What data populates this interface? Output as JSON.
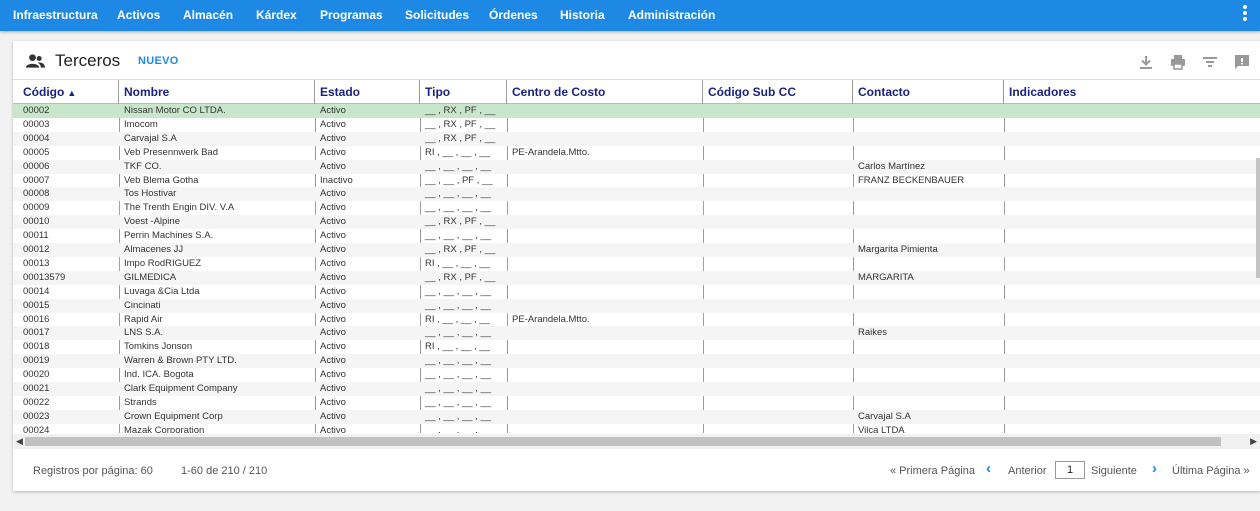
{
  "nav": {
    "items": [
      "Infraestructura",
      "Activos",
      "Almacén",
      "Kárdex",
      "Programas",
      "Solicitudes",
      "Órdenes",
      "Historia",
      "Administración"
    ]
  },
  "page": {
    "title": "Terceros",
    "new_label": "NUEVO"
  },
  "table": {
    "columns": [
      "Código",
      "Nombre",
      "Estado",
      "Tipo",
      "Centro de Costo",
      "Código Sub CC",
      "Contacto",
      "Indicadores"
    ],
    "rows": [
      [
        "00002",
        "Nissan Motor CO LTDA.",
        "Activo",
        "__ , RX , PF , __",
        "",
        "",
        "",
        ""
      ],
      [
        "00003",
        "Imocom",
        "Activo",
        "__ , RX , PF , __",
        "",
        "",
        "",
        ""
      ],
      [
        "00004",
        "Carvajal S.A",
        "Activo",
        "__ , RX , PF , __",
        "",
        "",
        "",
        ""
      ],
      [
        "00005",
        "Veb Presennwerk Bad",
        "Activo",
        "RI , __ , __ , __",
        "PE-Arandela.Mtto.",
        "",
        "",
        ""
      ],
      [
        "00006",
        "TKF CO.",
        "Activo",
        "__ , __ , __ , __",
        "",
        "",
        "Carlos Martínez",
        ""
      ],
      [
        "00007",
        "Veb Blema Gotha",
        "Inactivo",
        "__ , __ , PF , __",
        "",
        "",
        "FRANZ BECKENBAUER",
        ""
      ],
      [
        "00008",
        "Tos Hostivar",
        "Activo",
        "__ , __ , __ , __",
        "",
        "",
        "",
        ""
      ],
      [
        "00009",
        "The Trenth Engin DIV. V.A",
        "Activo",
        "__ , __ , __ , __",
        "",
        "",
        "",
        ""
      ],
      [
        "00010",
        "Voest -Alpine",
        "Activo",
        "__ , RX , PF , __",
        "",
        "",
        "",
        ""
      ],
      [
        "00011",
        "Perrin Machines S.A.",
        "Activo",
        "__ , __ , __ , __",
        "",
        "",
        "",
        ""
      ],
      [
        "00012",
        "Almacenes JJ",
        "Activo",
        "__ , RX , PF , __",
        "",
        "",
        "Margarita Pimienta",
        ""
      ],
      [
        "00013",
        "Impo RodRIGUEZ",
        "Activo",
        "RI , __ , __ , __",
        "",
        "",
        "",
        ""
      ],
      [
        "00013579",
        "GILMEDICA",
        "Activo",
        "__ , RX , PF , __",
        "",
        "",
        "MARGARITA",
        ""
      ],
      [
        "00014",
        "Luvaga &Cia Ltda",
        "Activo",
        "__ , __ , __ , __",
        "",
        "",
        "",
        ""
      ],
      [
        "00015",
        "Cincinati",
        "Activo",
        "__ , __ , __ , __",
        "",
        "",
        "",
        ""
      ],
      [
        "00016",
        "Rapid Air",
        "Activo",
        "RI , __ , __ , __",
        "PE-Arandela.Mtto.",
        "",
        "",
        ""
      ],
      [
        "00017",
        "LNS S.A.",
        "Activo",
        "__ , __ , __ , __",
        "",
        "",
        "Raikes",
        ""
      ],
      [
        "00018",
        "Tomkins Jonson",
        "Activo",
        "RI , __ , __ , __",
        "",
        "",
        "",
        ""
      ],
      [
        "00019",
        "Warren & Brown PTY LTD.",
        "Activo",
        "__ , __ , __ , __",
        "",
        "",
        "",
        ""
      ],
      [
        "00020",
        "Ind. ICA. Bogota",
        "Activo",
        "__ , __ , __ , __",
        "",
        "",
        "",
        ""
      ],
      [
        "00021",
        "Clark Equipment Company",
        "Activo",
        "__ , __ , __ , __",
        "",
        "",
        "",
        ""
      ],
      [
        "00022",
        "Strands",
        "Activo",
        "__ , __ , __ , __",
        "",
        "",
        "",
        ""
      ],
      [
        "00023",
        "Crown Equipment Corp",
        "Activo",
        "__ , __ , __ , __",
        "",
        "",
        "Carvajal S.A",
        ""
      ],
      [
        "00024",
        "Mazak Corporation",
        "Activo",
        "__ , __ , __ , __",
        "",
        "",
        "Vilca LTDA",
        ""
      ]
    ],
    "selected_row": 0
  },
  "footer": {
    "per_page_label": "Registros por página: 60",
    "range": "1-60 de 210 / 210",
    "first": "« Primera Página",
    "prev": "Anterior",
    "page_value": "1",
    "next": "Siguiente",
    "last": "Última Página »"
  },
  "colors": {
    "nav": "#1e88e5",
    "header_text": "#1a237e",
    "selected_row": "#c8e6c9"
  },
  "icons": [
    "group-icon",
    "download-icon",
    "print-icon",
    "filter-icon",
    "comment-icon",
    "sort-ascending-icon",
    "chevron-left-icon",
    "chevron-right-icon",
    "kebab-menu-icon"
  ]
}
